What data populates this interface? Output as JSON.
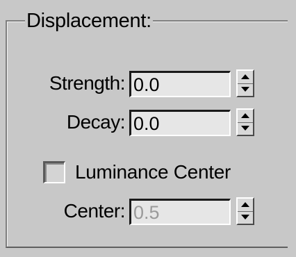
{
  "displacement_group": {
    "title": "Displacement:",
    "strength": {
      "label": "Strength:",
      "value": "0.0"
    },
    "decay": {
      "label": "Decay:",
      "value": "0.0"
    },
    "luminance_center": {
      "label": "Luminance Center",
      "checked": false
    },
    "center": {
      "label": "Center:",
      "value": "0.5",
      "enabled": false
    }
  },
  "icons": {
    "spinner_up": "triangle-up",
    "spinner_down": "triangle-down"
  }
}
